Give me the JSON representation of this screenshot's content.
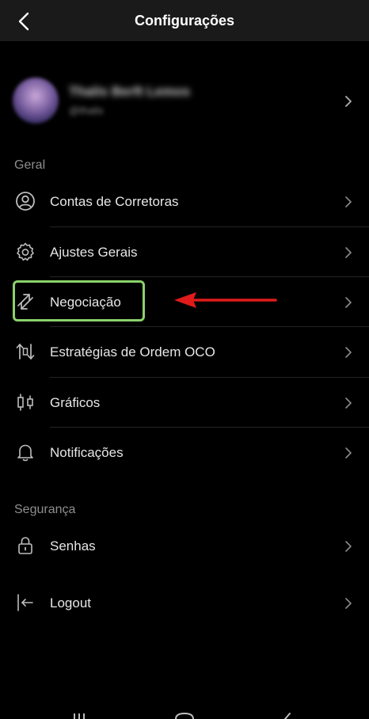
{
  "header": {
    "title": "Configurações"
  },
  "profile": {
    "name": "Thalis Berft Lemos",
    "subtitle": "@thalis"
  },
  "sections": {
    "general": "Geral",
    "security": "Segurança"
  },
  "items": {
    "accounts": "Contas de Corretoras",
    "general_settings": "Ajustes Gerais",
    "trading": "Negociação",
    "oco": "Estratégias de Ordem OCO",
    "charts": "Gráficos",
    "notifications": "Notificações",
    "passwords": "Senhas",
    "logout": "Logout"
  },
  "colors": {
    "background": "#000000",
    "header": "#1a1a1a",
    "highlight": "#8bd16a",
    "annotation_arrow": "#e01b1b"
  }
}
